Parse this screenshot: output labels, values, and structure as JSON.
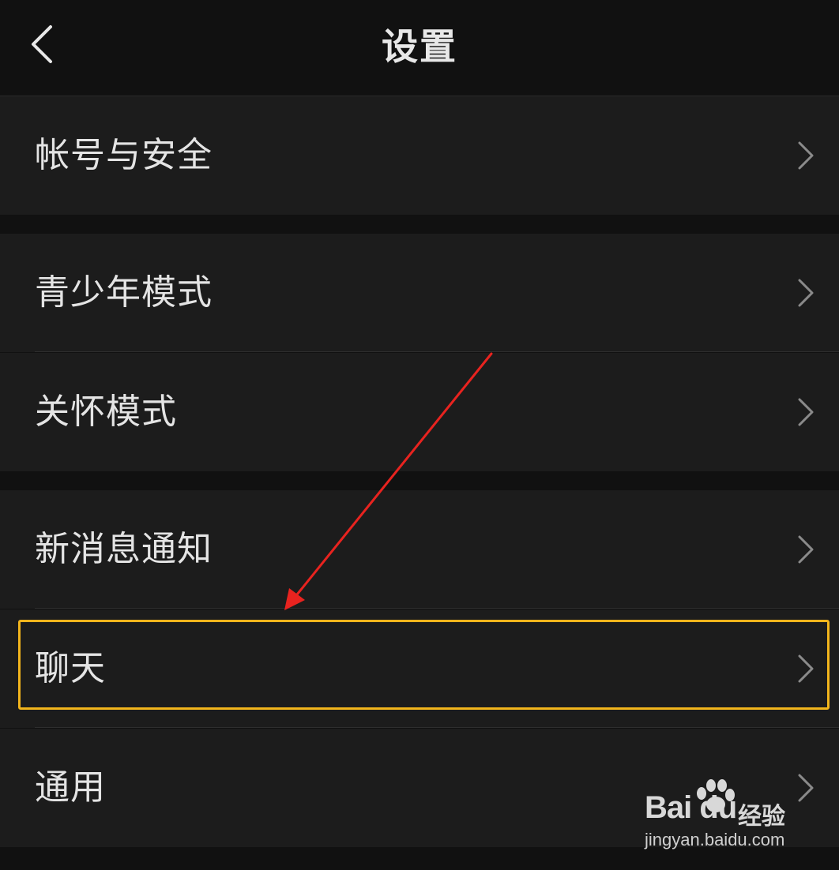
{
  "header": {
    "title": "设置",
    "back_icon": "chevron-left-icon"
  },
  "settings": {
    "group1": [
      {
        "label": "帐号与安全"
      }
    ],
    "group2": [
      {
        "label": "青少年模式"
      },
      {
        "label": "关怀模式"
      }
    ],
    "group3": [
      {
        "label": "新消息通知"
      },
      {
        "label": "聊天"
      },
      {
        "label": "通用"
      }
    ]
  },
  "annotation": {
    "highlight_color": "#f2b51c",
    "arrow_color": "#e8231f",
    "highlighted_item": "聊天"
  },
  "watermark": {
    "logo": "Bai du",
    "brand": "经验",
    "url": "jingyan.baidu.com"
  },
  "colors": {
    "background": "#111111",
    "row_background": "#1c1c1c",
    "text": "#e4e4e4",
    "chevron": "#8a8a8a"
  }
}
